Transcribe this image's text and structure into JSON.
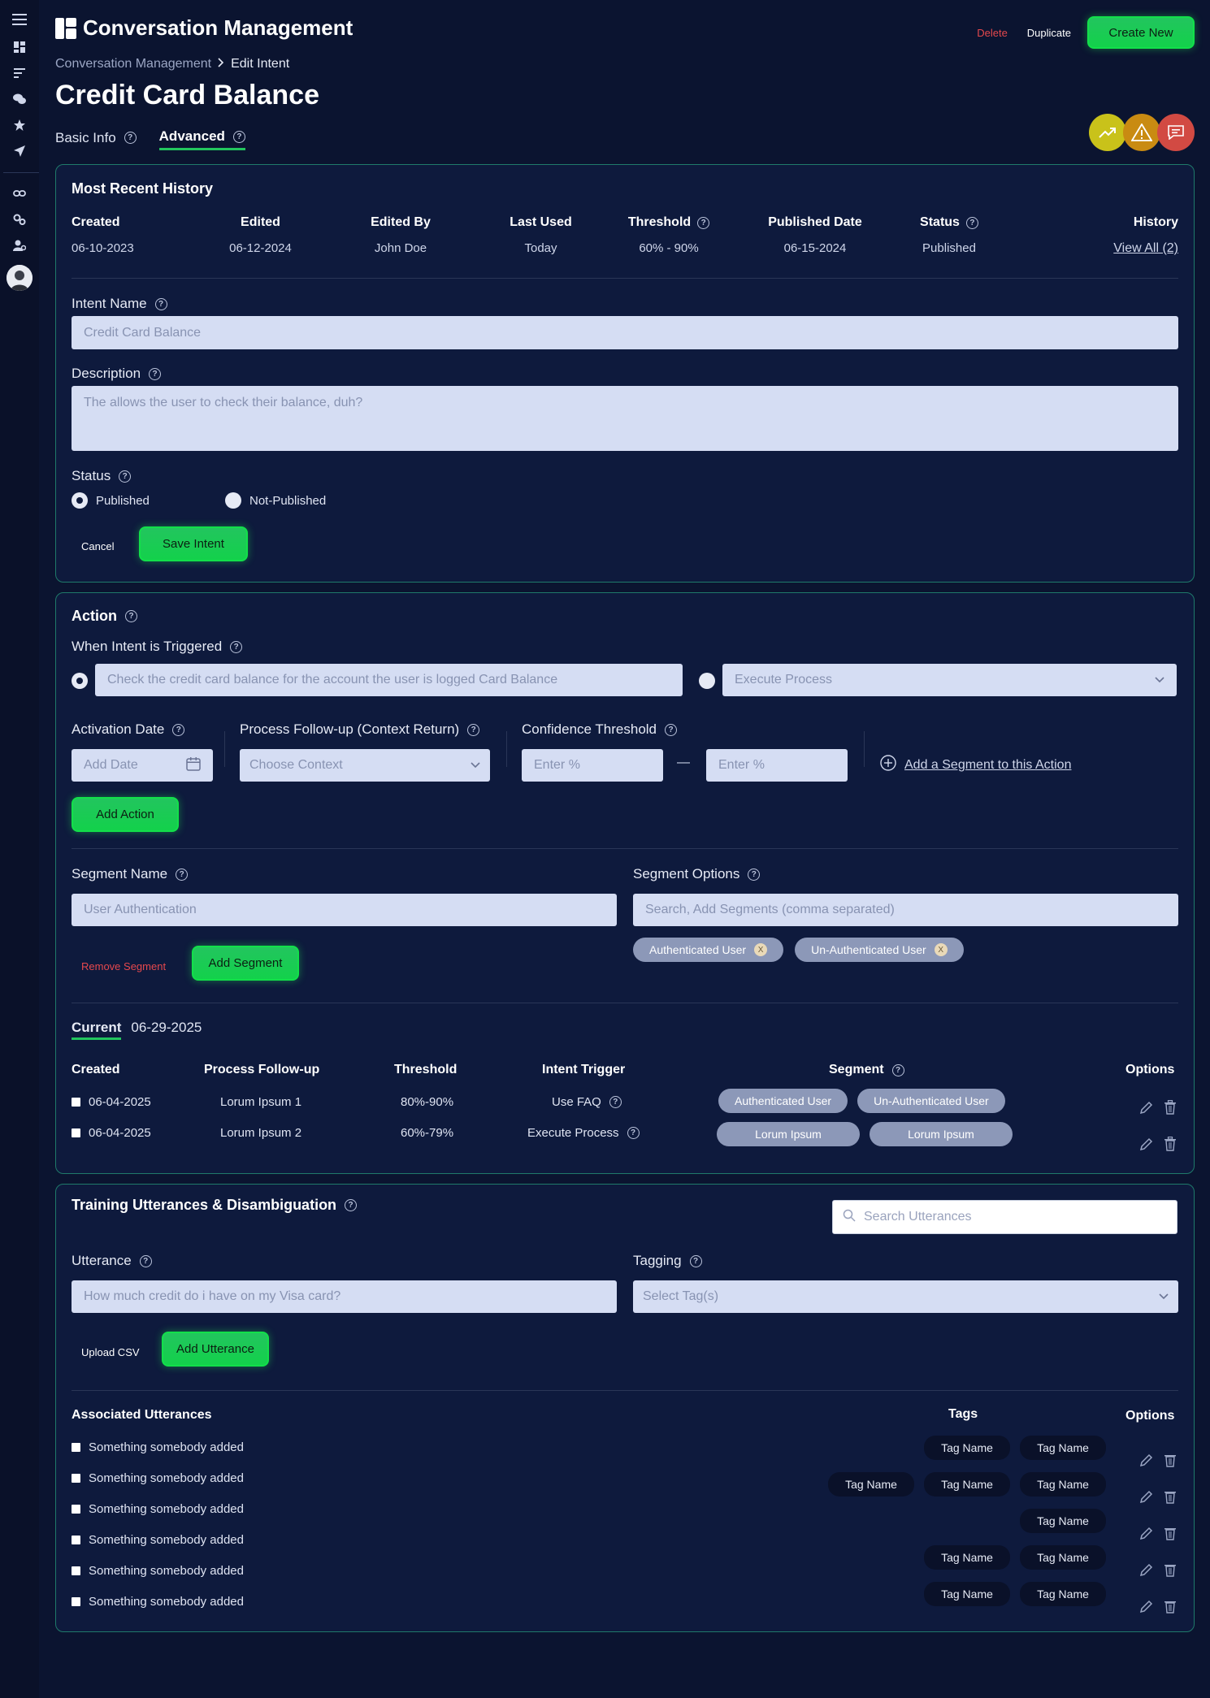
{
  "app": {
    "title": "Conversation Management"
  },
  "header": {
    "delete": "Delete",
    "duplicate": "Duplicate",
    "create_new": "Create New"
  },
  "breadcrumb": {
    "parent": "Conversation Management",
    "current": "Edit Intent"
  },
  "page": {
    "title": "Credit Card Balance"
  },
  "tabs": {
    "basic": "Basic Info",
    "advanced": "Advanced"
  },
  "history": {
    "title": "Most Recent History",
    "headers": [
      "Created",
      "Edited",
      "Edited By",
      "Last Used",
      "Threshold",
      "Published Date",
      "Status",
      "History"
    ],
    "values": [
      "06-10-2023",
      "06-12-2024",
      "John Doe",
      "Today",
      "60% - 90%",
      "06-15-2024",
      "Published",
      "View All (2)"
    ]
  },
  "intent": {
    "name_label": "Intent Name",
    "name_placeholder": "Credit Card Balance",
    "desc_label": "Description",
    "desc_placeholder": "The allows the user to check their balance, duh?",
    "status_label": "Status",
    "published": "Published",
    "not_published": "Not-Published",
    "cancel": "Cancel",
    "save": "Save Intent"
  },
  "action": {
    "title": "Action",
    "trigger_label": "When Intent is Triggered",
    "trigger_text": "Check the credit card balance for the account the user is logged  Card Balance",
    "process_select": "Execute Process",
    "activation_label": "Activation Date",
    "activation_placeholder": "Add Date",
    "followup_label": "Process Follow-up (Context Return)",
    "followup_placeholder": "Choose Context",
    "confidence_label": "Confidence Threshold",
    "enter_pct": "Enter %",
    "dash": "—",
    "add_segment_link": "Add a Segment to this Action",
    "add_action": "Add Action",
    "segment_name_label": "Segment Name",
    "segment_name_placeholder": "User Authentication",
    "segment_options_label": "Segment Options",
    "segment_options_placeholder": "Search, Add Segments (comma separated)",
    "chips": [
      "Authenticated User",
      "Un-Authenticated User"
    ],
    "chip_close": "X",
    "remove_segment": "Remove Segment",
    "add_segment": "Add Segment",
    "current_label": "Current",
    "current_date": "06-29-2025",
    "table_headers": [
      "Created",
      "Process Follow-up",
      "Threshold",
      "Intent Trigger",
      "Segment",
      "Options"
    ],
    "rows": [
      {
        "created": "06-04-2025",
        "followup": "Lorum Ipsum 1",
        "threshold": "80%-90%",
        "trigger": "Use FAQ",
        "segments": [
          "Authenticated User",
          "Un-Authenticated User"
        ]
      },
      {
        "created": "06-04-2025",
        "followup": "Lorum Ipsum 2",
        "threshold": "60%-79%",
        "trigger": "Execute Process",
        "segments": [
          "Lorum Ipsum",
          "Lorum Ipsum"
        ]
      }
    ]
  },
  "training": {
    "title": "Training Utterances & Disambiguation",
    "search_placeholder": "Search Utterances",
    "utterance_label": "Utterance",
    "utterance_placeholder": "How much credit do i have on my Visa card?",
    "tagging_label": "Tagging",
    "tagging_placeholder": "Select Tag(s)",
    "upload_csv": "Upload CSV",
    "add_utterance": "Add Utterance",
    "assoc_label": "Associated Utterances",
    "tags_label": "Tags",
    "options_label": "Options",
    "utterances": [
      {
        "text": "Something somebody added",
        "tags": [
          "Tag Name",
          "Tag Name"
        ]
      },
      {
        "text": "Something somebody added",
        "tags": [
          "Tag Name",
          "Tag Name",
          "Tag Name"
        ]
      },
      {
        "text": "Something somebody added",
        "tags": [
          "Tag Name"
        ]
      },
      {
        "text": "Something somebody added",
        "tags": [
          "Tag Name",
          "Tag Name"
        ]
      },
      {
        "text": "Something somebody added",
        "tags": [
          "Tag Name",
          "Tag Name"
        ]
      },
      {
        "text": "Something somebody added",
        "tags": []
      }
    ]
  }
}
